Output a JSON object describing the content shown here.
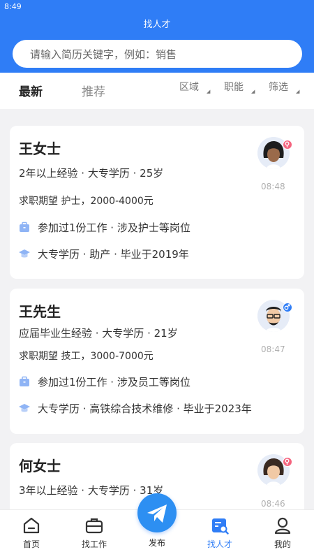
{
  "status": {
    "time": "8:49"
  },
  "header": {
    "title": "找人才"
  },
  "search": {
    "placeholder": "请输入简历关键字，例如：销售"
  },
  "tabs": {
    "latest": "最新",
    "recommend": "推荐"
  },
  "filters": {
    "region": "区域",
    "function": "职能",
    "screen": "筛选"
  },
  "candidates": [
    {
      "name": "王女士",
      "summary": "2年以上经验 · 大专学历 · 25岁",
      "expectation": "求职期望 护士，2000-4000元",
      "experience": "参加过1份工作 · 涉及护士等岗位",
      "education": "大专学历 · 助产 · 毕业于2019年",
      "time": "08:48",
      "gender": "female"
    },
    {
      "name": "王先生",
      "summary": "应届毕业生经验 · 大专学历 · 21岁",
      "expectation": "求职期望 技工，3000-7000元",
      "experience": "参加过1份工作 · 涉及员工等岗位",
      "education": "大专学历 · 高铁综合技术维修 · 毕业于2023年",
      "time": "08:47",
      "gender": "male"
    },
    {
      "name": "何女士",
      "summary": "3年以上经验 · 大专学历 · 31岁",
      "time": "08:46",
      "gender": "female"
    }
  ],
  "nav": {
    "home": "首页",
    "jobs": "找工作",
    "publish": "发布",
    "talent": "找人才",
    "mine": "我的"
  },
  "colors": {
    "primary": "#2f7df6",
    "female_badge": "#f5647e",
    "male_badge": "#2f7df6",
    "background": "#f2f2f4"
  }
}
